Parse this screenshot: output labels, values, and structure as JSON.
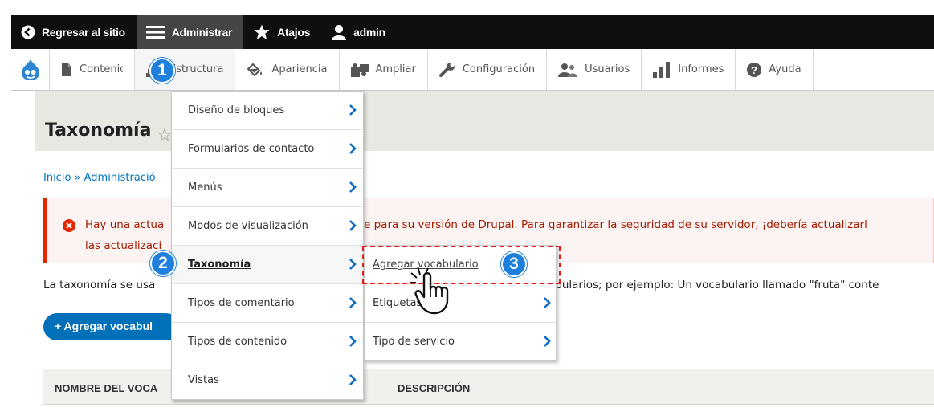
{
  "toolbar": {
    "back": "Regresar al sitio",
    "manage": "Administrar",
    "shortcuts": "Atajos",
    "user": "admin"
  },
  "tray": {
    "items": [
      "Contenido",
      "Estructura",
      "Apariencia",
      "Ampliar",
      "Configuración",
      "Usuarios",
      "Informes",
      "Ayuda"
    ]
  },
  "page": {
    "title": "Taxonomía",
    "breadcrumb": "Inicio » Administració",
    "message_line1_start": "Hay una actua",
    "message_line1_end": "e para su versión de Drupal. Para garantizar la seguridad de su servidor, ¡debería actualizarl",
    "message_line2": "las actualizaci",
    "intro_start": "La taxonomía se usa",
    "intro_end": "abularios; por ejemplo: Un vocabulario llamado \"fruta\" conte",
    "add_button": "+ Agregar vocabul",
    "col_name": "NOMBRE DEL VOCA",
    "col_description": "DESCRIPCIÓN"
  },
  "structure_menu": {
    "items": [
      "Diseño de bloques",
      "Formularios de contacto",
      "Menús",
      "Modos de visualización",
      "Taxonomía",
      "Tipos de comentario",
      "Tipos de contenido",
      "Vistas"
    ]
  },
  "taxonomy_submenu": {
    "items": [
      "Agregar vocabulario",
      "Etiquetas",
      "Tipo de servicio"
    ]
  },
  "badges": [
    "1",
    "2",
    "3"
  ],
  "colors": {
    "toolbar_bg": "#0f0f0f",
    "active_toolbar": "#444444",
    "link": "#0074bd",
    "error": "#e62600",
    "button": "#0071b8",
    "badge": "#1f7fdc",
    "highlight_dash": "#e41b1b"
  }
}
